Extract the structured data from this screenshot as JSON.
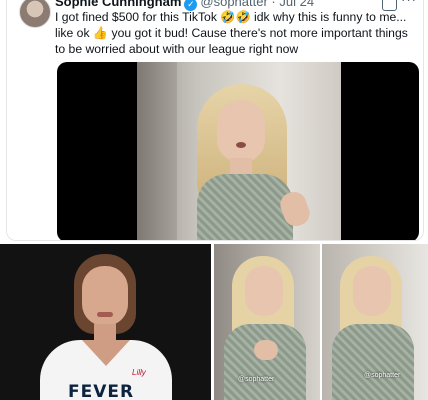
{
  "tweet": {
    "display_name": "Sophie Cunningham",
    "verified_icon": "verified-check-icon",
    "handle": "@sophatter",
    "separator": "·",
    "date": "Jul 24",
    "text": "I got fined $500 for this TikTok 🤣🤣  idk why this is funny to me... like ok 👍 you got it bud! Cause there's not more important things to be worried about with our league right now"
  },
  "photos": {
    "jersey_word": "FEVER",
    "jersey_patch": "Lilly",
    "watermark_left": "@sophatter",
    "watermark_right": "@sophatter"
  },
  "colors": {
    "accent": "#1d9bf0",
    "text": "#0f1419",
    "muted": "#536471"
  }
}
